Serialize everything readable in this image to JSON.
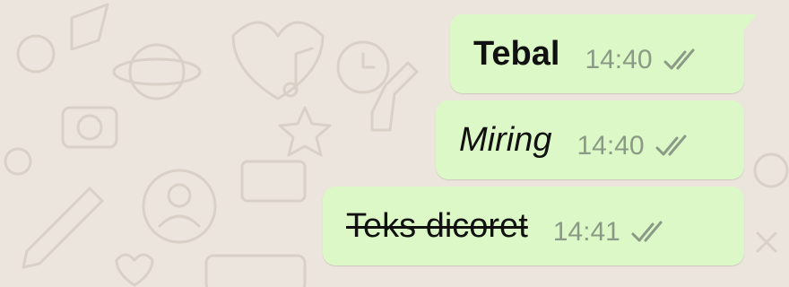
{
  "chat": {
    "messages": [
      {
        "text": "Tebal",
        "style": "bold",
        "time": "14:40",
        "status": "read-double-check-icon"
      },
      {
        "text": "Miring",
        "style": "italic",
        "time": "14:40",
        "status": "read-double-check-icon"
      },
      {
        "text": "Teks dicoret",
        "style": "strikethrough",
        "time": "14:41",
        "status": "read-double-check-icon"
      }
    ]
  },
  "colors": {
    "bubble_outgoing": "#dcf8c6",
    "wallpaper": "#ece5dd",
    "timestamp": "#8a9a86"
  }
}
